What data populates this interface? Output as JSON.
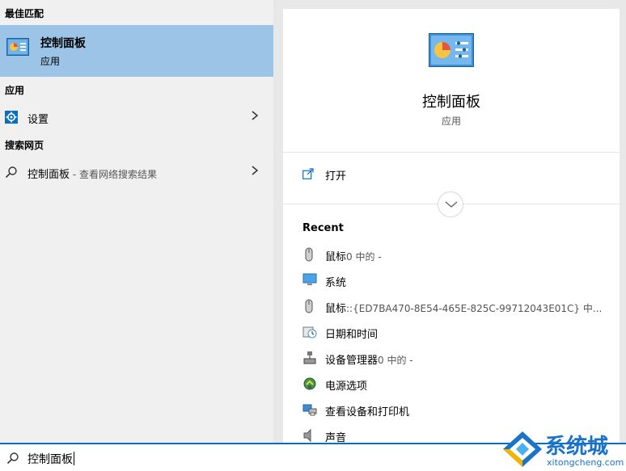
{
  "left": {
    "best_match_header": "最佳匹配",
    "best_match": {
      "name": "控制面板",
      "type": "应用",
      "icon": "control-panel-icon"
    },
    "apps_header": "应用",
    "apps": [
      {
        "label": "设置",
        "icon": "gear-icon"
      }
    ],
    "web_header": "搜索网页",
    "web": [
      {
        "label": "控制面板",
        "suffix": " - 查看网络搜索结果",
        "icon": "search-icon"
      }
    ]
  },
  "right": {
    "title": "控制面板",
    "type": "应用",
    "open_label": "打开",
    "recent_title": "Recent",
    "recent": [
      {
        "label": "鼠标",
        "suffix": "0 中的 -",
        "icon": "mouse-icon"
      },
      {
        "label": "系统",
        "suffix": "",
        "icon": "monitor-icon"
      },
      {
        "label": "鼠标",
        "suffix": "::{ED7BA470-8E54-465E-825C-99712043E01C} 中...",
        "icon": "mouse-icon"
      },
      {
        "label": "日期和时间",
        "suffix": "",
        "icon": "clock-icon"
      },
      {
        "label": "设备管理器",
        "suffix": "0 中的 -",
        "icon": "device-manager-icon"
      },
      {
        "label": "电源选项",
        "suffix": "",
        "icon": "power-options-icon"
      },
      {
        "label": "查看设备和打印机",
        "suffix": "",
        "icon": "printer-icon"
      },
      {
        "label": "声音",
        "suffix": "",
        "icon": "speaker-icon"
      }
    ]
  },
  "search": {
    "query": "控制面板"
  },
  "watermark": {
    "text": "系统城",
    "url": "xitongcheng.com"
  },
  "colors": {
    "selection": "#9cc4e6",
    "accent": "#0a6fc2"
  }
}
